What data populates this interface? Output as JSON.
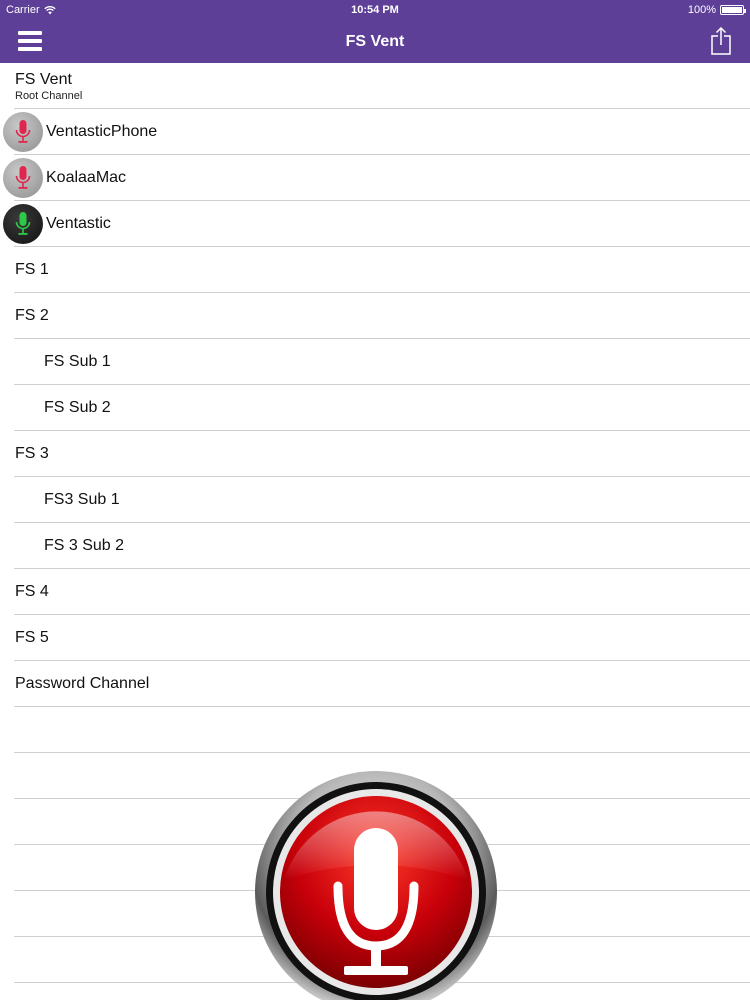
{
  "status_bar": {
    "carrier": "Carrier",
    "time": "10:54 PM",
    "battery": "100%"
  },
  "nav": {
    "title": "FS Vent",
    "menu_icon": "hamburger-menu-icon",
    "share_icon": "share-icon"
  },
  "colors": {
    "nav_background": "#5d3f97",
    "mic_idle": "#e0264f",
    "mic_talking": "#2fc94a",
    "big_mic_red": "#c8000a"
  },
  "root": {
    "name": "FS Vent",
    "subtitle": "Root Channel"
  },
  "users": [
    {
      "name": "VentasticPhone",
      "state": "idle"
    },
    {
      "name": "KoalaaMac",
      "state": "idle"
    },
    {
      "name": "Ventastic",
      "state": "talking"
    }
  ],
  "channels": [
    {
      "name": "FS 1",
      "level": 0
    },
    {
      "name": "FS 2",
      "level": 0
    },
    {
      "name": "FS Sub 1",
      "level": 1
    },
    {
      "name": "FS Sub 2",
      "level": 1
    },
    {
      "name": "FS 3",
      "level": 0
    },
    {
      "name": "FS3 Sub 1",
      "level": 1
    },
    {
      "name": "FS 3 Sub 2",
      "level": 1
    },
    {
      "name": "FS 4",
      "level": 0
    },
    {
      "name": "FS 5",
      "level": 0
    },
    {
      "name": "Password Channel",
      "level": 0
    }
  ],
  "push_to_talk": {
    "icon": "microphone-icon"
  }
}
